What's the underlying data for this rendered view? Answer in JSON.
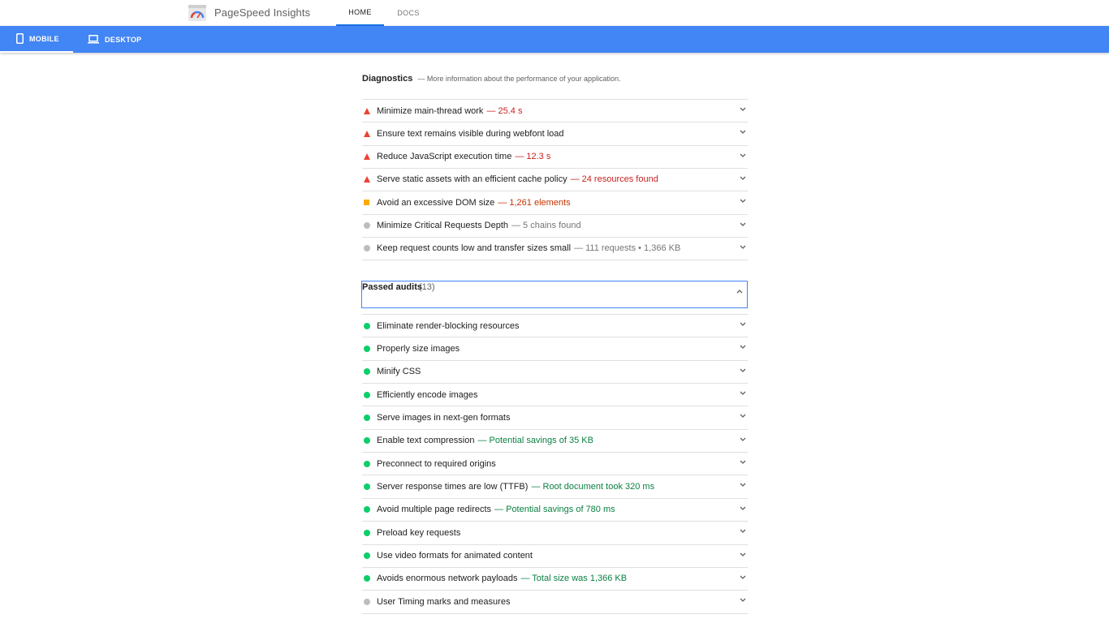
{
  "header": {
    "app_title": "PageSpeed Insights",
    "nav": [
      {
        "label": "HOME",
        "active": true
      },
      {
        "label": "DOCS",
        "active": false
      }
    ],
    "logo_icon": "pagespeed-gauge-icon"
  },
  "device_tabs": [
    {
      "label": "MOBILE",
      "icon": "smartphone-icon",
      "active": true
    },
    {
      "label": "DESKTOP",
      "icon": "laptop-icon",
      "active": false
    }
  ],
  "diagnostics": {
    "title": "Diagnostics",
    "subtitle": "— More information about the performance of your application.",
    "items": [
      {
        "label": "Minimize main-thread work",
        "detail": "— 25.4 s",
        "status": "fail"
      },
      {
        "label": "Ensure text remains visible during webfont load",
        "detail": "",
        "status": "fail"
      },
      {
        "label": "Reduce JavaScript execution time",
        "detail": "— 12.3 s",
        "status": "fail"
      },
      {
        "label": "Serve static assets with an efficient cache policy",
        "detail": "— 24 resources found",
        "status": "fail"
      },
      {
        "label": "Avoid an excessive DOM size",
        "detail": "— 1,261 elements",
        "status": "average"
      },
      {
        "label": "Minimize Critical Requests Depth",
        "detail": "— 5 chains found",
        "status": "info"
      },
      {
        "label": "Keep request counts low and transfer sizes small",
        "detail": "— 111 requests • 1,366 KB",
        "status": "info"
      }
    ]
  },
  "passed_audits": {
    "title": "Passed audits",
    "count": "(13)",
    "items": [
      {
        "label": "Eliminate render-blocking resources",
        "detail": "",
        "status": "pass"
      },
      {
        "label": "Properly size images",
        "detail": "",
        "status": "pass"
      },
      {
        "label": "Minify CSS",
        "detail": "",
        "status": "pass"
      },
      {
        "label": "Efficiently encode images",
        "detail": "",
        "status": "pass"
      },
      {
        "label": "Serve images in next-gen formats",
        "detail": "",
        "status": "pass"
      },
      {
        "label": "Enable text compression",
        "detail": "— Potential savings of 35 KB",
        "status": "pass"
      },
      {
        "label": "Preconnect to required origins",
        "detail": "",
        "status": "pass"
      },
      {
        "label": "Server response times are low (TTFB)",
        "detail": "— Root document took 320 ms",
        "status": "pass"
      },
      {
        "label": "Avoid multiple page redirects",
        "detail": "— Potential savings of 780 ms",
        "status": "pass"
      },
      {
        "label": "Preload key requests",
        "detail": "",
        "status": "pass"
      },
      {
        "label": "Use video formats for animated content",
        "detail": "",
        "status": "pass"
      },
      {
        "label": "Avoids enormous network payloads",
        "detail": "— Total size was 1,366 KB",
        "status": "pass"
      },
      {
        "label": "User Timing marks and measures",
        "detail": "",
        "status": "info"
      }
    ]
  },
  "colors": {
    "accent": "#4285f4",
    "fail": "#eb4335",
    "average": "#fbab00",
    "pass": "#0cce6b",
    "info": "#bdbdbd"
  }
}
